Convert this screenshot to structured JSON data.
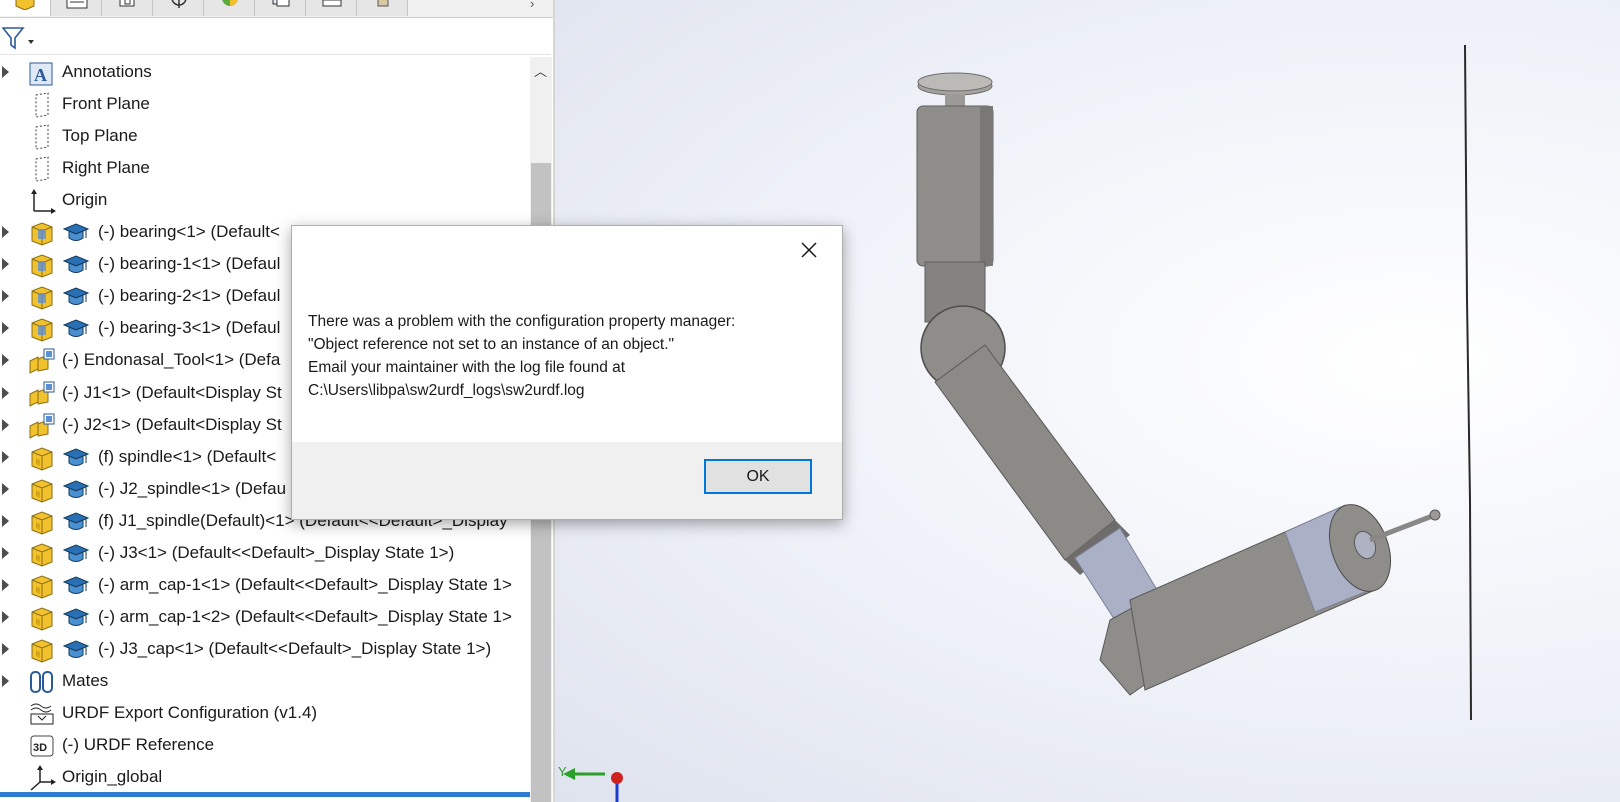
{
  "feature_tree": {
    "items": [
      {
        "label": "Annotations",
        "icon": "annotations-icon",
        "expandable": true
      },
      {
        "label": "Front Plane",
        "icon": "plane-icon",
        "expandable": false
      },
      {
        "label": "Top Plane",
        "icon": "plane-icon",
        "expandable": false
      },
      {
        "label": "Right Plane",
        "icon": "plane-icon",
        "expandable": false
      },
      {
        "label": "Origin",
        "icon": "origin-icon",
        "expandable": false
      },
      {
        "label": "(-) bearing<1> (Default<",
        "icon": "part-icon",
        "expandable": true,
        "has_cap": true
      },
      {
        "label": "(-) bearing-1<1> (Defaul",
        "icon": "part-icon",
        "expandable": true,
        "has_cap": true
      },
      {
        "label": "(-) bearing-2<1> (Defaul",
        "icon": "part-icon",
        "expandable": true,
        "has_cap": true
      },
      {
        "label": "(-) bearing-3<1> (Defaul",
        "icon": "part-icon",
        "expandable": true,
        "has_cap": true
      },
      {
        "label": "(-) Endonasal_Tool<1> (Defa",
        "icon": "assembly-icon",
        "expandable": true,
        "has_cap": false
      },
      {
        "label": "(-) J1<1> (Default<Display St",
        "icon": "assembly-icon",
        "expandable": true,
        "has_cap": false
      },
      {
        "label": "(-) J2<1> (Default<Display St",
        "icon": "assembly-icon",
        "expandable": true,
        "has_cap": false
      },
      {
        "label": "(f) spindle<1> (Default<",
        "icon": "part-yellow-icon",
        "expandable": true,
        "has_cap": true
      },
      {
        "label": "(-) J2_spindle<1> (Defau",
        "icon": "part-yellow-icon",
        "expandable": true,
        "has_cap": true
      },
      {
        "label": "(f) J1_spindle(Default)<1> (Default<<Default>_Display",
        "icon": "part-yellow-icon",
        "expandable": true,
        "has_cap": true
      },
      {
        "label": "(-) J3<1> (Default<<Default>_Display State 1>)",
        "icon": "part-yellow-icon",
        "expandable": true,
        "has_cap": true
      },
      {
        "label": "(-) arm_cap-1<1> (Default<<Default>_Display State 1>",
        "icon": "part-yellow-icon",
        "expandable": true,
        "has_cap": true
      },
      {
        "label": "(-) arm_cap-1<2> (Default<<Default>_Display State 1>",
        "icon": "part-yellow-icon",
        "expandable": true,
        "has_cap": true
      },
      {
        "label": "(-) J3_cap<1> (Default<<Default>_Display State 1>)",
        "icon": "part-yellow-icon",
        "expandable": true,
        "has_cap": true
      },
      {
        "label": "Mates",
        "icon": "mates-icon",
        "expandable": true
      },
      {
        "label": "URDF Export Configuration (v1.4)",
        "icon": "urdf-config-icon",
        "expandable": false
      },
      {
        "label": "(-) URDF Reference",
        "icon": "3d-sketch-icon",
        "expandable": false
      },
      {
        "label": "Origin_global",
        "icon": "coordinate-system-icon",
        "expandable": false
      }
    ]
  },
  "dialog": {
    "message_lines": [
      "There was a problem with the configuration property manager:",
      "\"Object reference not set to an instance of an object.\"",
      "Email your maintainer with the log file found at",
      "C:\\Users\\libpa\\sw2urdf_logs\\sw2urdf.log"
    ],
    "ok_label": "OK"
  },
  "triad": {
    "y_label": "Y"
  },
  "colors": {
    "accent": "#0078d7",
    "selection_bar": "#2f7dd1",
    "model_gray": "#8f8d8a",
    "model_blue_gray": "#aab0c6"
  }
}
